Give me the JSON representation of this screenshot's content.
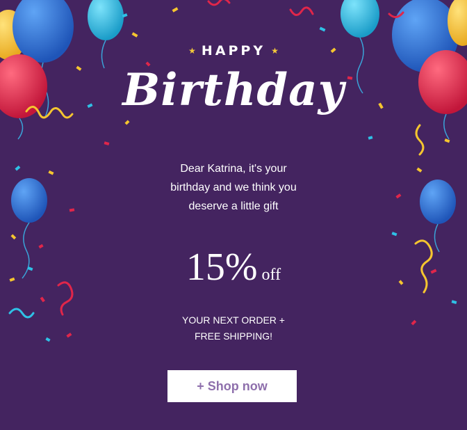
{
  "heading": {
    "happy": "HAPPY",
    "birthday": "Birthday"
  },
  "message": {
    "line1": "Dear Katrina, it's your",
    "line2": "birthday and we think you",
    "line3": "deserve a little gift"
  },
  "discount": {
    "value": "15%",
    "suffix": "off"
  },
  "offer": {
    "line1": "YOUR NEXT ORDER +",
    "line2": "FREE SHIPPING!"
  },
  "cta": {
    "label": "+ Shop now"
  },
  "colors": {
    "background": "#442460",
    "button_text": "#8e6fac",
    "star": "#f4c93a",
    "balloon_blue": "#2d6fd6",
    "balloon_red": "#e0264a",
    "balloon_yellow": "#f5c52f",
    "balloon_cyan": "#2fc1e6"
  },
  "icons": {
    "star": "star-icon",
    "balloon": "balloon-icon",
    "confetti": "confetti-icon",
    "streamer": "streamer-icon"
  }
}
